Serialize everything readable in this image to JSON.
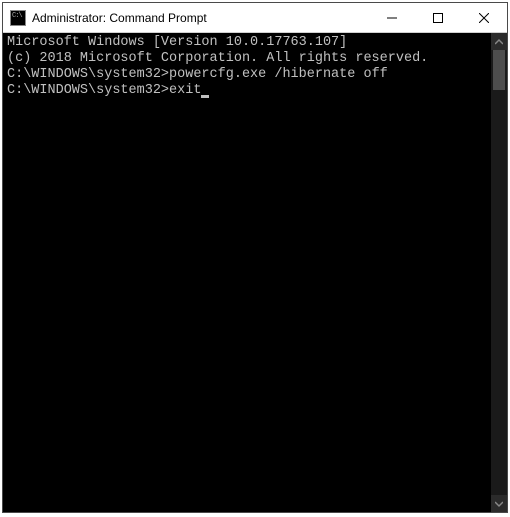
{
  "window": {
    "title": "Administrator: Command Prompt"
  },
  "terminal": {
    "line1": "Microsoft Windows [Version 10.0.17763.107]",
    "line2": "(c) 2018 Microsoft Corporation. All rights reserved.",
    "blank1": "",
    "prompt1": "C:\\WINDOWS\\system32>",
    "cmd1": "powercfg.exe /hibernate off",
    "blank2": "",
    "prompt2": "C:\\WINDOWS\\system32>",
    "cmd2": "exit"
  }
}
